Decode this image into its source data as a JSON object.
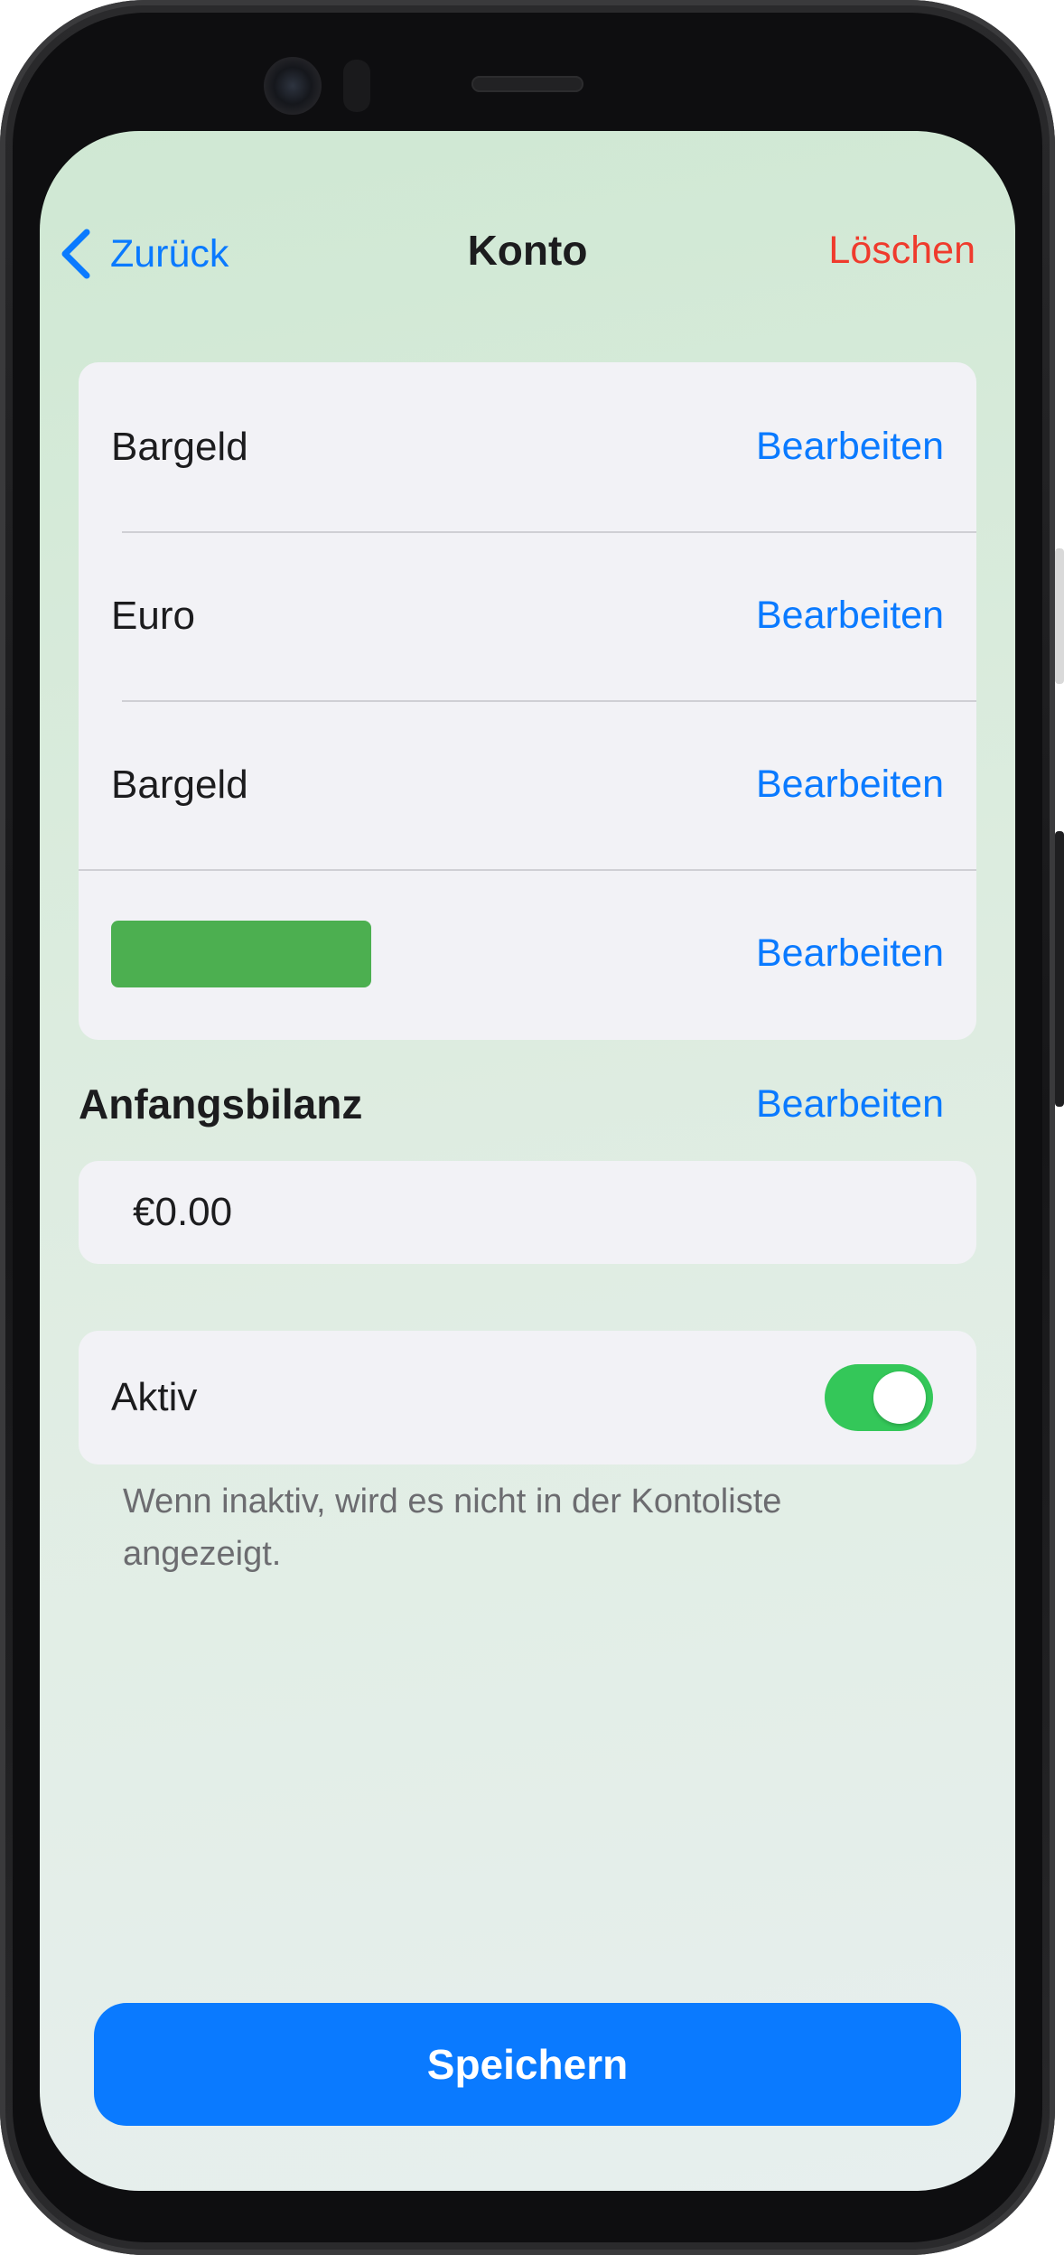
{
  "nav": {
    "back_label": "Zurück",
    "title": "Konto",
    "delete_label": "Löschen"
  },
  "details": {
    "rows": [
      {
        "label": "Bargeld",
        "action": "Bearbeiten"
      },
      {
        "label": "Euro",
        "action": "Bearbeiten"
      },
      {
        "label": "Bargeld",
        "action": "Bearbeiten"
      },
      {
        "label": "",
        "action": "Bearbeiten",
        "color": "#4caf50"
      }
    ]
  },
  "balance": {
    "title": "Anfangsbilanz",
    "action": "Bearbeiten",
    "value": "€0.00"
  },
  "active": {
    "label": "Aktiv",
    "enabled": true,
    "hint": "Wenn inaktiv, wird es nicht in der Kontoliste angezeigt."
  },
  "save_label": "Speichern",
  "colors": {
    "accent": "#0a7aff",
    "danger": "#ef3b2d",
    "toggle_on": "#34c759",
    "account_color": "#4caf50"
  }
}
